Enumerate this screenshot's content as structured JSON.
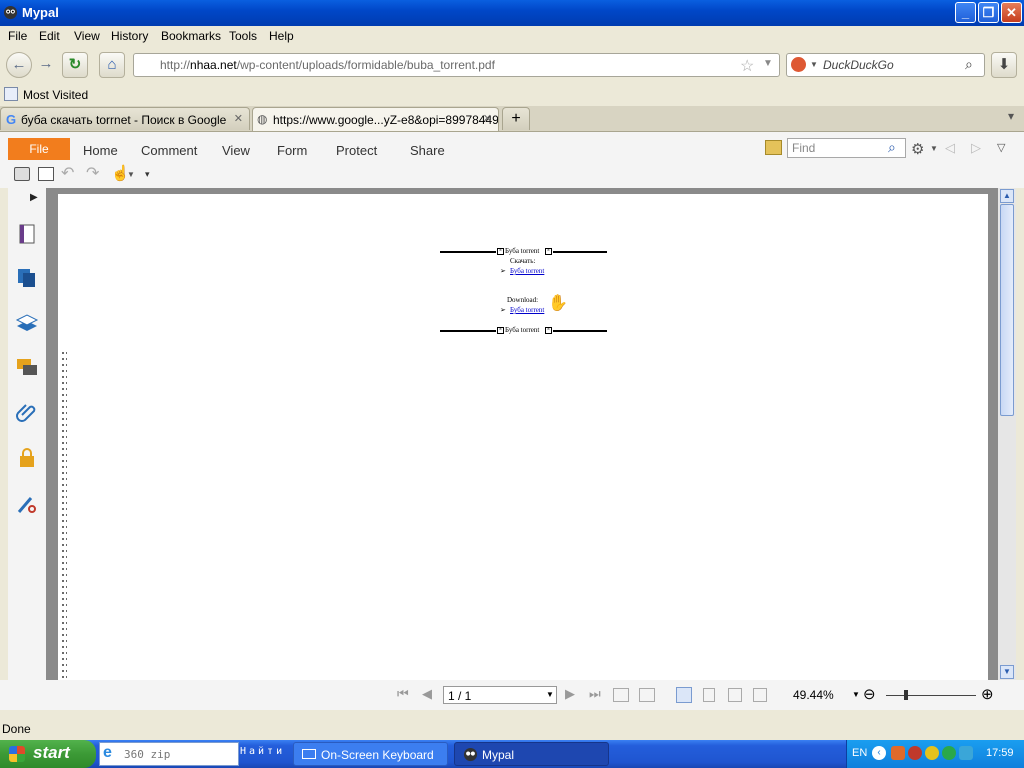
{
  "window": {
    "title": "Mypal",
    "controls": [
      "minimize",
      "restore",
      "close"
    ]
  },
  "menubar": {
    "items": [
      "File",
      "Edit",
      "View",
      "History",
      "Bookmarks",
      "Tools",
      "Help"
    ]
  },
  "navigation": {
    "url_prefix": "http://",
    "url_host": "nhaa.net",
    "url_path": "/wp-content/uploads/formidable/buba_torrent.pdf",
    "search_placeholder": "DuckDuckGo"
  },
  "bookmarks": {
    "most_visited": "Most Visited"
  },
  "tabs": [
    {
      "label": "буба скачать torrnet - Поиск в Google",
      "active": false
    },
    {
      "label": "https://www.google...yZ-e8&opi=89978449",
      "active": true
    }
  ],
  "pdf_toolbar": {
    "file_label": "File",
    "menu": [
      "Home",
      "Comment",
      "View",
      "Form",
      "Protect",
      "Share"
    ],
    "find_placeholder": "Find"
  },
  "pdf_content": {
    "header_title": "Буба torrent",
    "download_ru_label": "Скачать:",
    "link_1": "Буба torrent",
    "download_en_label": "Download:",
    "link_2": "Буба torrent",
    "footer_title": "Буба torrent"
  },
  "pdf_bottom": {
    "page_indicator": "1 / 1",
    "zoom": "49.44%"
  },
  "statusbar": {
    "text": "Done"
  },
  "taskbar": {
    "start_label": "start",
    "quicksearch_value": "360 zip",
    "search_label": "Найти",
    "tasks": [
      "On-Screen Keyboard",
      "Mypal"
    ],
    "language": "EN",
    "clock": "17:59"
  },
  "colors": {
    "file_button": "#f27d1d",
    "titlebar": "#0047c8",
    "taskbar": "#245edb",
    "start": "#3c9a36"
  }
}
